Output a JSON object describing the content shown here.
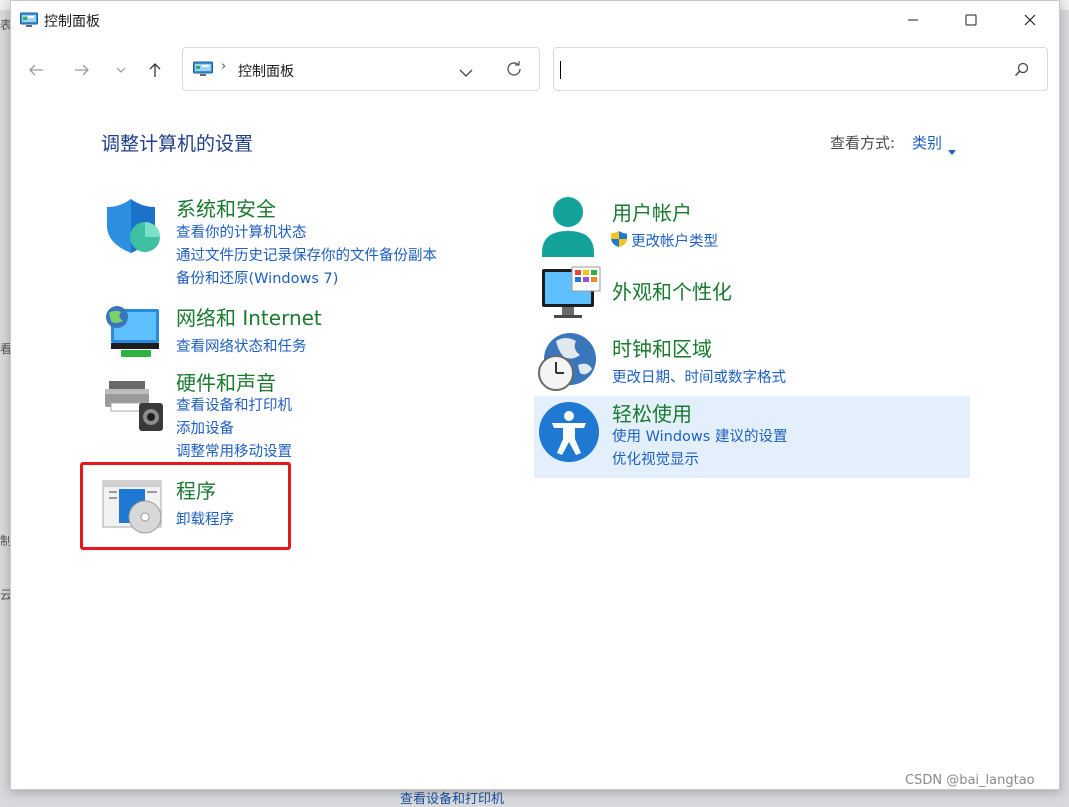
{
  "window": {
    "title": "控制面板"
  },
  "address_bar": {
    "path": "控制面板",
    "separator": "›"
  },
  "search": {
    "placeholder": ""
  },
  "header": {
    "page_title": "调整计算机的设置",
    "view_label": "查看方式:",
    "view_value": "类别"
  },
  "categories": {
    "security": {
      "title": "系统和安全",
      "links": [
        "查看你的计算机状态",
        "通过文件历史记录保存你的文件备份副本",
        "备份和还原(Windows 7)"
      ]
    },
    "network": {
      "title": "网络和 Internet",
      "links": [
        "查看网络状态和任务"
      ]
    },
    "hardware": {
      "title": "硬件和声音",
      "links": [
        "查看设备和打印机",
        "添加设备",
        "调整常用移动设置"
      ]
    },
    "programs": {
      "title": "程序",
      "links": [
        "卸载程序"
      ]
    },
    "accounts": {
      "title": "用户帐户",
      "links": [
        "更改帐户类型"
      ]
    },
    "appearance": {
      "title": "外观和个性化",
      "links": []
    },
    "clock": {
      "title": "时钟和区域",
      "links": [
        "更改日期、时间或数字格式"
      ]
    },
    "ease": {
      "title": "轻松使用",
      "links": [
        "使用 Windows 建议的设置",
        "优化视觉显示"
      ]
    }
  },
  "background": {
    "fragments": [
      "表",
      "看",
      "制",
      "云",
      "查看设备和打印机"
    ]
  },
  "watermark": "CSDN @bai_langtao",
  "colors": {
    "category_title": "#1a7a2f",
    "link": "#1f5fc1",
    "page_title": "#1f3f8a",
    "highlight": "#e3f0fb",
    "annotation_box": "#e8151b"
  }
}
